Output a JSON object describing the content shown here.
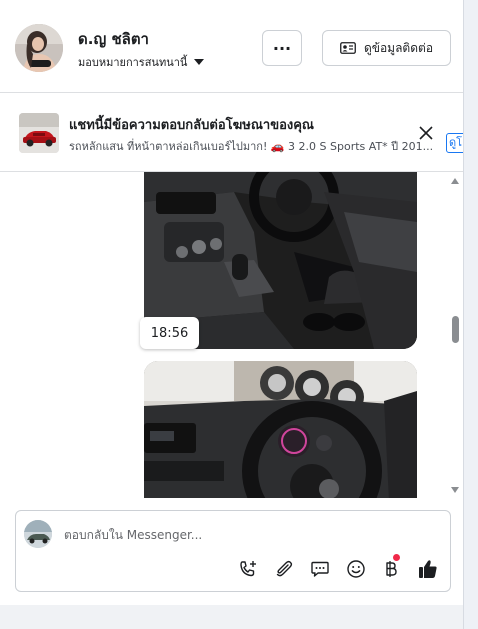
{
  "header": {
    "contact_name": "ด.ญ ชลิตา",
    "assign_label": "มอบหมายการสนทนานี้",
    "more_label": "···",
    "view_contact_label": "ดูข้อมูลติดต่อ"
  },
  "ad_banner": {
    "title": "แชทนี้มีข้อความตอบกลับต่อโฆษณาของคุณ",
    "subtitle": "รถหลักแสน ที่หน้าตาหล่อเกินเบอร์ไปมาก! 🚗 3 2.0 S Sports AT* ปี 201...",
    "side_label": "ดูโ"
  },
  "messages": {
    "timestamp": "18:56"
  },
  "composer": {
    "placeholder": "ตอบกลับใน Messenger..."
  },
  "icons": {
    "more": "more-icon",
    "contact_card": "contact-card-icon",
    "close": "close-icon",
    "call_add": "call-add-icon",
    "attach": "paperclip-icon",
    "quick_reply": "chat-bubble-icon",
    "emoji": "emoji-icon",
    "baht": "baht-icon",
    "like": "thumbs-up-icon"
  },
  "colors": {
    "accent": "#1877f2",
    "notification": "#f02849",
    "text": "#1c1e21"
  }
}
